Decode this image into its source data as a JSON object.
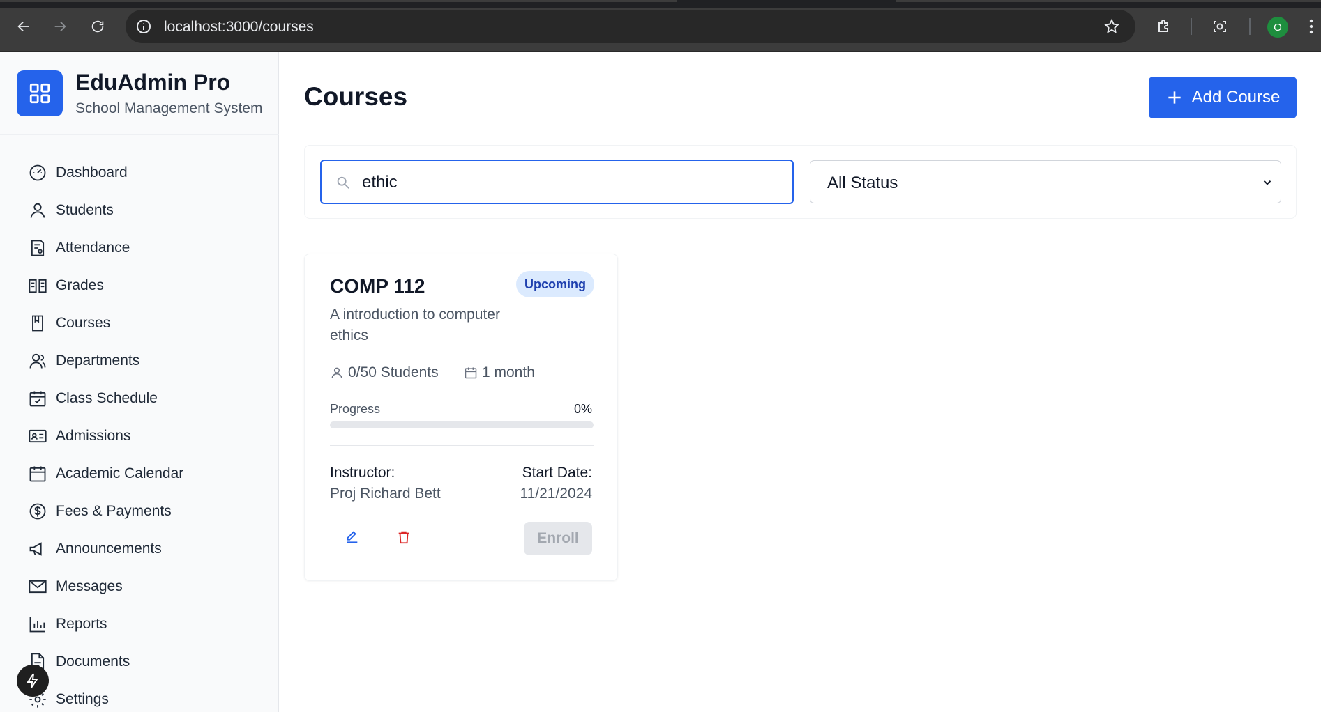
{
  "browser": {
    "url": "localhost:3000/courses",
    "profile_initial": "O"
  },
  "sidebar": {
    "brand_name": "EduAdmin Pro",
    "brand_subtitle": "School Management System",
    "items": [
      {
        "label": "Dashboard",
        "icon": "dashboard-icon"
      },
      {
        "label": "Students",
        "icon": "user-icon"
      },
      {
        "label": "Attendance",
        "icon": "attendance-icon"
      },
      {
        "label": "Grades",
        "icon": "book-open-icon"
      },
      {
        "label": "Courses",
        "icon": "book-icon"
      },
      {
        "label": "Departments",
        "icon": "users-icon"
      },
      {
        "label": "Class Schedule",
        "icon": "calendar-check-icon"
      },
      {
        "label": "Admissions",
        "icon": "id-card-icon"
      },
      {
        "label": "Academic Calendar",
        "icon": "calendar-icon"
      },
      {
        "label": "Fees & Payments",
        "icon": "dollar-icon"
      },
      {
        "label": "Announcements",
        "icon": "megaphone-icon"
      },
      {
        "label": "Messages",
        "icon": "mail-icon"
      },
      {
        "label": "Reports",
        "icon": "bar-chart-icon"
      },
      {
        "label": "Documents",
        "icon": "file-icon"
      },
      {
        "label": "Settings",
        "icon": "gear-icon"
      }
    ]
  },
  "main": {
    "title": "Courses",
    "add_button_label": "Add Course",
    "search": {
      "value": "ethic",
      "placeholder": ""
    },
    "status_filter": {
      "selected": "All Status"
    }
  },
  "courses": [
    {
      "code": "COMP 112",
      "status": "Upcoming",
      "description": "A introduction to computer ethics",
      "students": "0/50 Students",
      "duration": "1 month",
      "progress_label": "Progress",
      "progress_text": "0%",
      "progress_percent": 0,
      "instructor_label": "Instructor:",
      "instructor": "Proj Richard Bett",
      "start_label": "Start Date:",
      "start_date": "11/21/2024",
      "enroll_label": "Enroll"
    }
  ],
  "colors": {
    "accent": "#2563eb",
    "badge_bg": "#dbeafe",
    "badge_text": "#1e40af",
    "delete": "#dc2626"
  }
}
